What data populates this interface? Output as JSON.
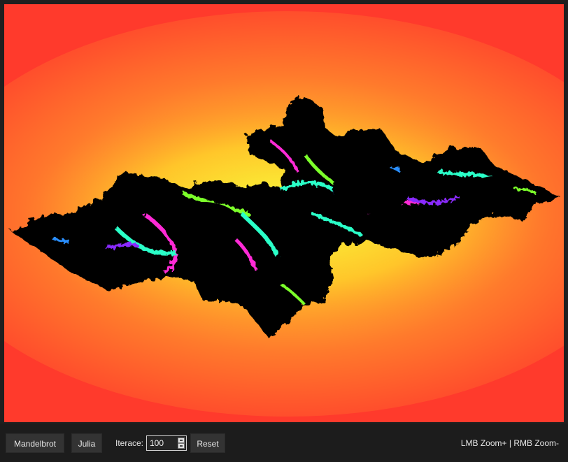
{
  "toolbar": {
    "mandelbrot_label": "Mandelbrot",
    "julia_label": "Julia",
    "iterations_label": "Iterace:",
    "iterations_value": "100",
    "reset_label": "Reset",
    "hint": "LMB Zoom+ | RMB Zoom-"
  },
  "fractal": {
    "type": "julia",
    "max_iterations": 100,
    "background_color": "#ff3a2c",
    "set_color": "#000000",
    "palette": [
      "#ff3a2c",
      "#ff6b2c",
      "#ffb02c",
      "#f5ff2c",
      "#7cff2c",
      "#2cffc8",
      "#2c8fff",
      "#8a2cff",
      "#ff2cd6"
    ]
  },
  "colors": {
    "app_background": "#1f1f1f",
    "button_background": "#333333",
    "text": "#e6e6e6"
  }
}
